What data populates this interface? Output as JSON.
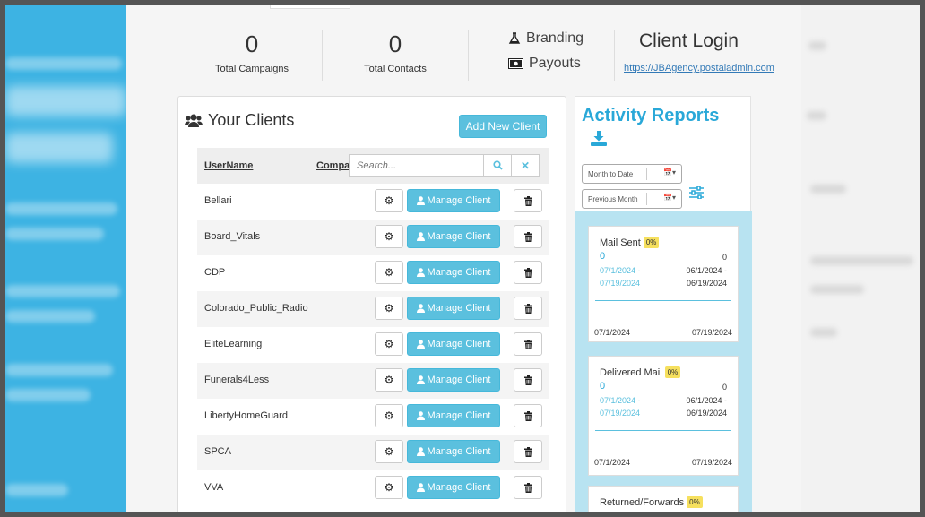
{
  "stats": [
    {
      "value": "0",
      "label": "Total Campaigns"
    },
    {
      "value": "0",
      "label": "Total Contacts"
    }
  ],
  "links": {
    "branding": "Branding",
    "payouts": "Payouts",
    "client_login_title": "Client Login",
    "client_login_url": "https://JBAgency.postaladmin.com"
  },
  "clients": {
    "title": "Your Clients",
    "add_button": "Add New Client",
    "col_username": "UserName",
    "col_company": "Company",
    "search_placeholder": "Search...",
    "manage_label": "Manage Client",
    "rows": [
      {
        "name": "Bellari"
      },
      {
        "name": "Board_Vitals"
      },
      {
        "name": "CDP"
      },
      {
        "name": "Colorado_Public_Radio"
      },
      {
        "name": "EliteLearning"
      },
      {
        "name": "Funerals4Less"
      },
      {
        "name": "LibertyHomeGuard"
      },
      {
        "name": "SPCA"
      },
      {
        "name": "VVA"
      }
    ]
  },
  "activity": {
    "title": "Activity Reports",
    "range1": "Month to Date",
    "range2": "Previous Month",
    "cards": [
      {
        "title": "Mail Sent",
        "badge": "0%",
        "value": "0",
        "prev_value": "0",
        "range_a": "07/1/2024 -",
        "range_b": "07/19/2024",
        "prev_a": "06/1/2024 -",
        "prev_b": "06/19/2024",
        "start": "07/1/2024",
        "end": "07/19/2024"
      },
      {
        "title": "Delivered Mail",
        "badge": "0%",
        "value": "0",
        "prev_value": "0",
        "range_a": "07/1/2024 -",
        "range_b": "07/19/2024",
        "prev_a": "06/1/2024 -",
        "prev_b": "06/19/2024",
        "start": "07/1/2024",
        "end": "07/19/2024"
      },
      {
        "title": "Returned/Forwards",
        "badge": "0%"
      }
    ]
  },
  "colors": {
    "accent": "#5bc0de",
    "title_blue": "#29a8d8",
    "left_panel": "#3db3e3",
    "badge": "#f6e05e"
  }
}
